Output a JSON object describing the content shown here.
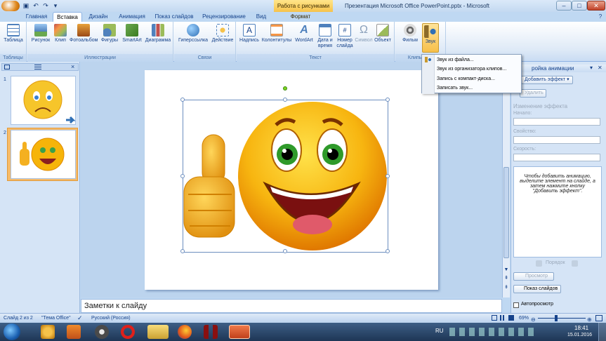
{
  "window": {
    "contextual_tab_group": "Работа с рисунками",
    "title": "Презентация Microsoft Office PowerPoint.pptx - Microsoft PowerPoint",
    "minimize": "–",
    "maximize": "□",
    "close": "✕"
  },
  "quick_access": {
    "save": "▣",
    "undo": "↶",
    "redo": "↷",
    "more": "▾"
  },
  "tabs": [
    {
      "label": "Главная"
    },
    {
      "label": "Вставка",
      "active": true
    },
    {
      "label": "Дизайн"
    },
    {
      "label": "Анимация"
    },
    {
      "label": "Показ слайдов"
    },
    {
      "label": "Рецензирование"
    },
    {
      "label": "Вид"
    },
    {
      "label": "Формат"
    }
  ],
  "help_icon": "?",
  "ribbon": {
    "groups": [
      {
        "label": "Таблицы",
        "buttons": [
          "Таблица"
        ]
      },
      {
        "label": "Иллюстрации",
        "buttons": [
          "Рисунок",
          "Клип",
          "Фотоальбом",
          "Фигуры",
          "SmartArt",
          "Диаграмма"
        ]
      },
      {
        "label": "Связи",
        "buttons": [
          "Гиперссылка",
          "Действие"
        ]
      },
      {
        "label": "Текст",
        "buttons": [
          "Надпись",
          "Колонтитулы",
          "WordArt",
          "Дата и время",
          "Номер слайда",
          "Символ",
          "Объект"
        ]
      },
      {
        "label": "Клипы мул",
        "buttons": [
          "Фильм",
          "Звук"
        ]
      }
    ],
    "date_label_line1": "Дата и",
    "date_label_line2": "время",
    "num_label_line1": "Номер",
    "num_label_line2": "слайда"
  },
  "sound_menu": {
    "items": [
      "Звук из файла...",
      "Звук из организатора клипов...",
      "Запись с компакт-диска...",
      "Записать звук..."
    ]
  },
  "slides_panel": {
    "close": "×",
    "slide_numbers": [
      "1",
      "2"
    ]
  },
  "notes_placeholder": "Заметки к слайду",
  "animation_pane": {
    "title": "ройка анимации",
    "add_effect": "Добавить эффект",
    "remove": "Удалить",
    "change_heading": "Изменение эффекта",
    "start_label": "Начало:",
    "property_label": "Свойство:",
    "speed_label": "Скорость:",
    "info": "Чтобы добавить анимацию, выделите элемент на слайде, а затем нажмите кнопку \"Добавить эффект\".",
    "order_label": "Порядок",
    "preview": "Просмотр",
    "slideshow": "Показ слайдов",
    "autopreview": "Автопросмотр"
  },
  "status_bar": {
    "slide_info": "Слайд 2 из 2",
    "theme": "\"Тема Office\"",
    "language": "Русский (Россия)",
    "zoom": "69%"
  },
  "taskbar": {
    "lang": "RU",
    "time": "18:41",
    "date": "15.01.2016"
  },
  "colors": {
    "ribbon_blue": "#bfd8f2",
    "accent_orange": "#f6bb6a",
    "smiley_yellow": "#f6b40a"
  }
}
